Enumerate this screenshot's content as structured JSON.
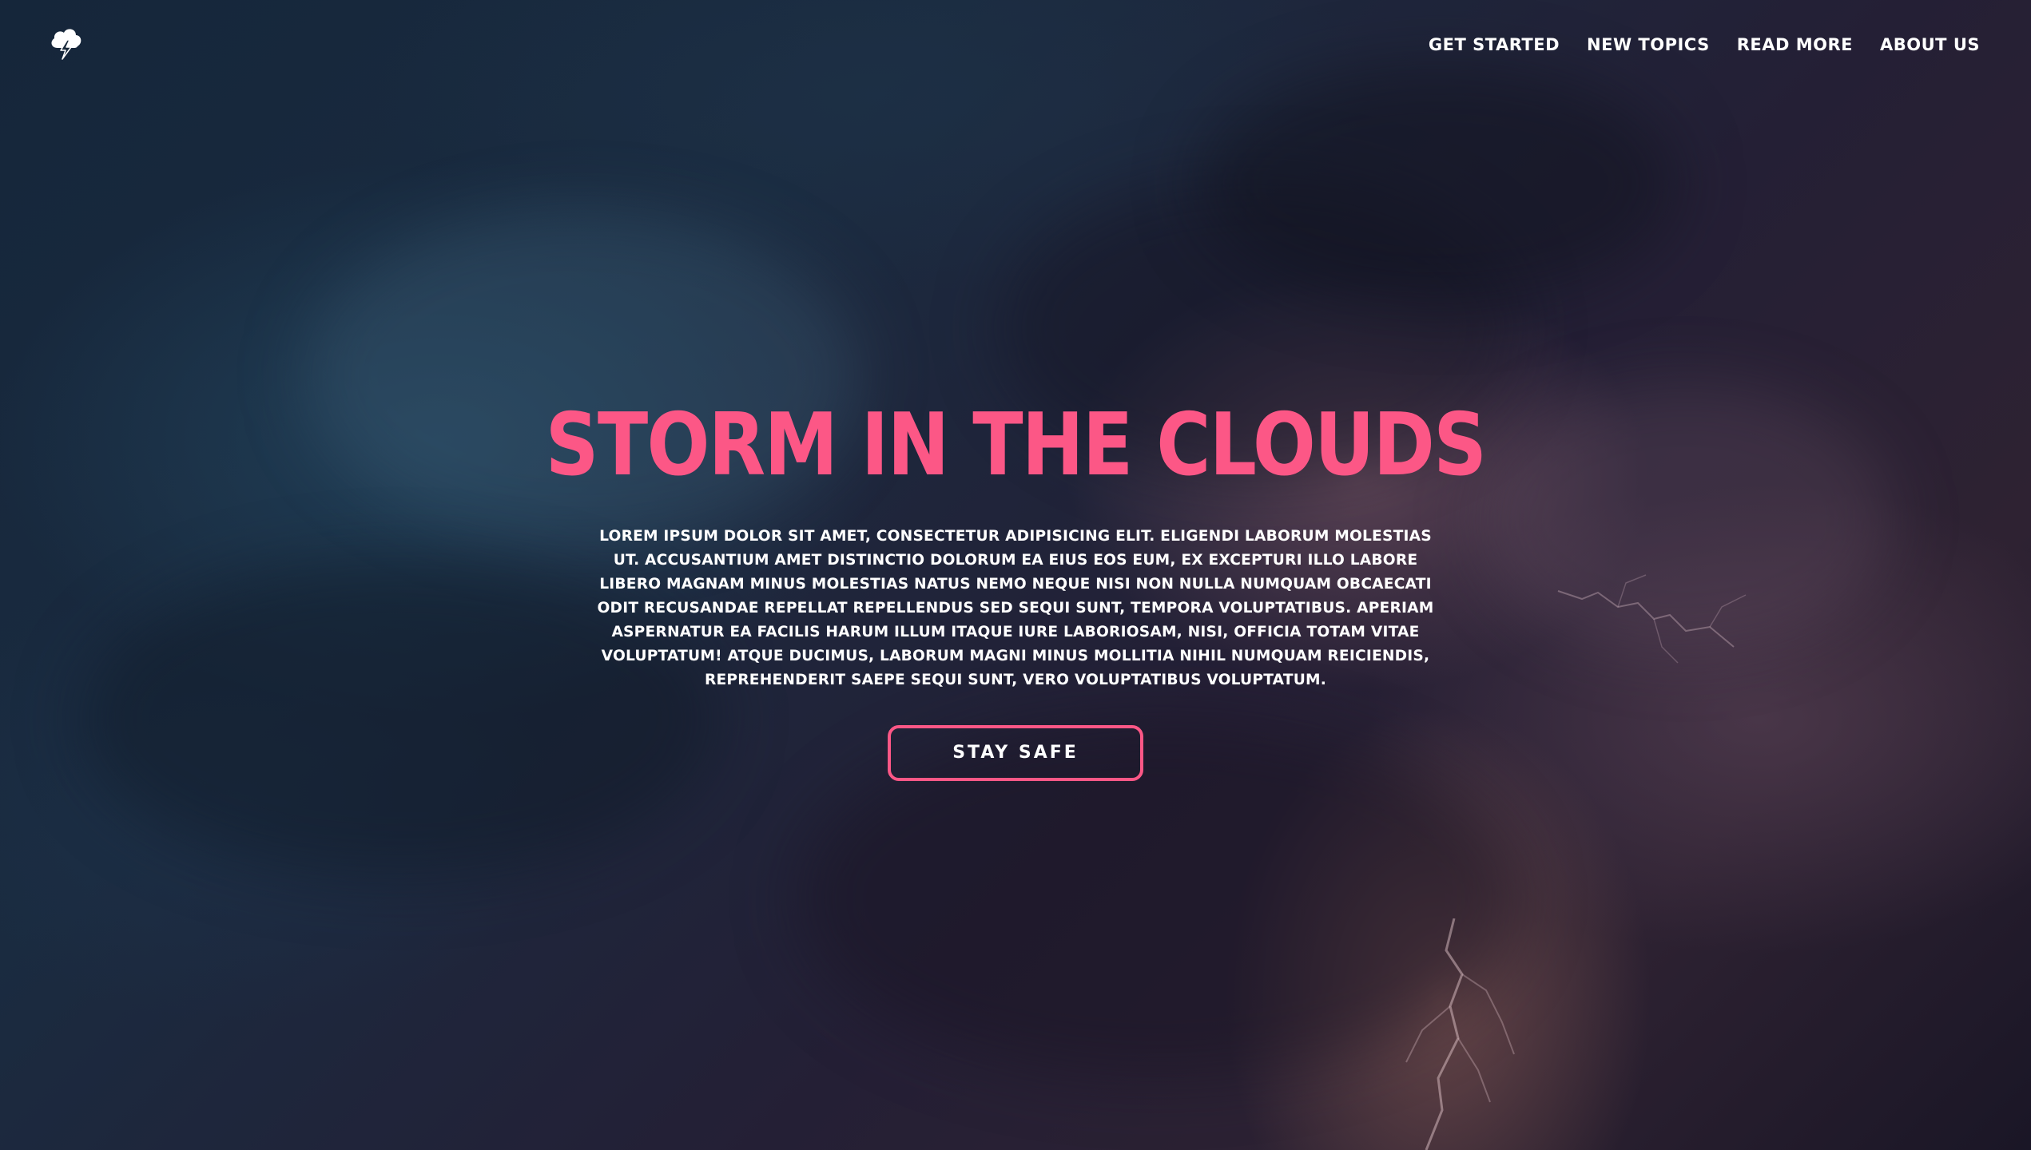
{
  "header": {
    "logo_icon": "cloud-lightning-icon",
    "nav": [
      {
        "label": "GET STARTED"
      },
      {
        "label": "NEW TOPICS"
      },
      {
        "label": "READ MORE"
      },
      {
        "label": "ABOUT US"
      }
    ]
  },
  "hero": {
    "title": "STORM IN THE CLOUDS",
    "body": "LOREM IPSUM DOLOR SIT AMET, CONSECTETUR ADIPISICING ELIT. ELIGENDI LABORUM MOLESTIAS UT. ACCUSANTIUM AMET DISTINCTIO DOLORUM EA EIUS EOS EUM, EX EXCEPTURI ILLO LABORE LIBERO MAGNAM MINUS MOLESTIAS NATUS NEMO NEQUE NISI NON NULLA NUMQUAM OBCAECATI ODIT RECUSANDAE REPELLAT REPELLENDUS SED SEQUI SUNT, TEMPORA VOLUPTATIBUS. APERIAM ASPERNATUR EA FACILIS HARUM ILLUM ITAQUE IURE LABORIOSAM, NISI, OFFICIA TOTAM VITAE VOLUPTATUM! ATQUE DUCIMUS, LABORUM MAGNI MINUS MOLLITIA NIHIL NUMQUAM REICIENDIS, REPREHENDERIT SAEPE SEQUI SUNT, VERO VOLUPTATIBUS VOLUPTATUM.",
    "cta_label": "STAY SAFE"
  },
  "colors": {
    "accent": "#fc5786",
    "text": "#ffffff",
    "background": "#15263a"
  }
}
